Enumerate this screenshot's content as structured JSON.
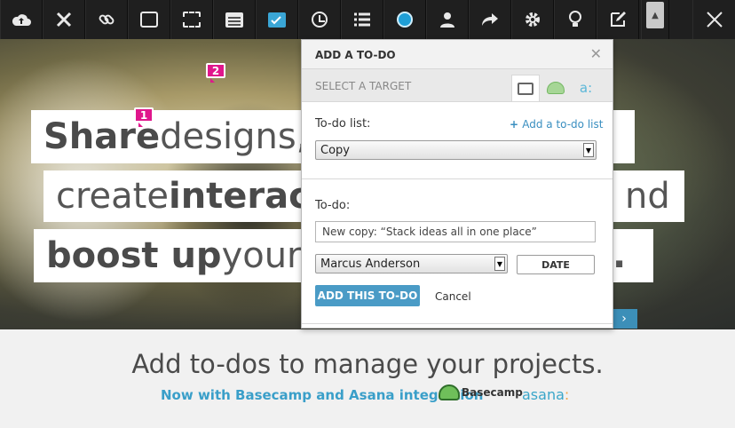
{
  "toolbar": {
    "tools": [
      "cloud-upload",
      "tools",
      "link",
      "comment",
      "select-area",
      "notes",
      "todo",
      "clock",
      "list",
      "color-picker",
      "user",
      "share",
      "settings",
      "lightbulb",
      "edit",
      "collapse",
      "close"
    ],
    "active_tool": "todo"
  },
  "hero": {
    "line1_bold": "Share",
    "line1_rest": " designs,",
    "line2_pre": "create ",
    "line2_bold": "interac",
    "line2_tail": "nd",
    "line3_bold": "boost up",
    "line3_rest": " your",
    "line3_tail": ".",
    "badge1": "1",
    "badge2": "2"
  },
  "dialog": {
    "title": "ADD A TO-DO",
    "target_label": "SELECT A TARGET",
    "target_asana_glyph": "a:",
    "todo_list_label": "To-do list:",
    "add_list_link": "Add a to-do list",
    "list_selected": "Copy",
    "todo_label": "To-do:",
    "todo_value": "New copy: “Stack ideas all in one place”",
    "assignee_selected": "Marcus Anderson",
    "date_label": "DATE",
    "submit_label": "ADD THIS TO-DO",
    "cancel_label": "Cancel"
  },
  "footer": {
    "tagline": "Add to-dos to manage your projects.",
    "subline": "Now with Basecamp and Asana integration",
    "basecamp_logo": "Basecamp",
    "asana_logo": "asana",
    "asana_dots": ":"
  },
  "colors": {
    "accent": "#4a9bc6",
    "badge": "#e0168c",
    "toolbar": "#1f1f1f"
  }
}
